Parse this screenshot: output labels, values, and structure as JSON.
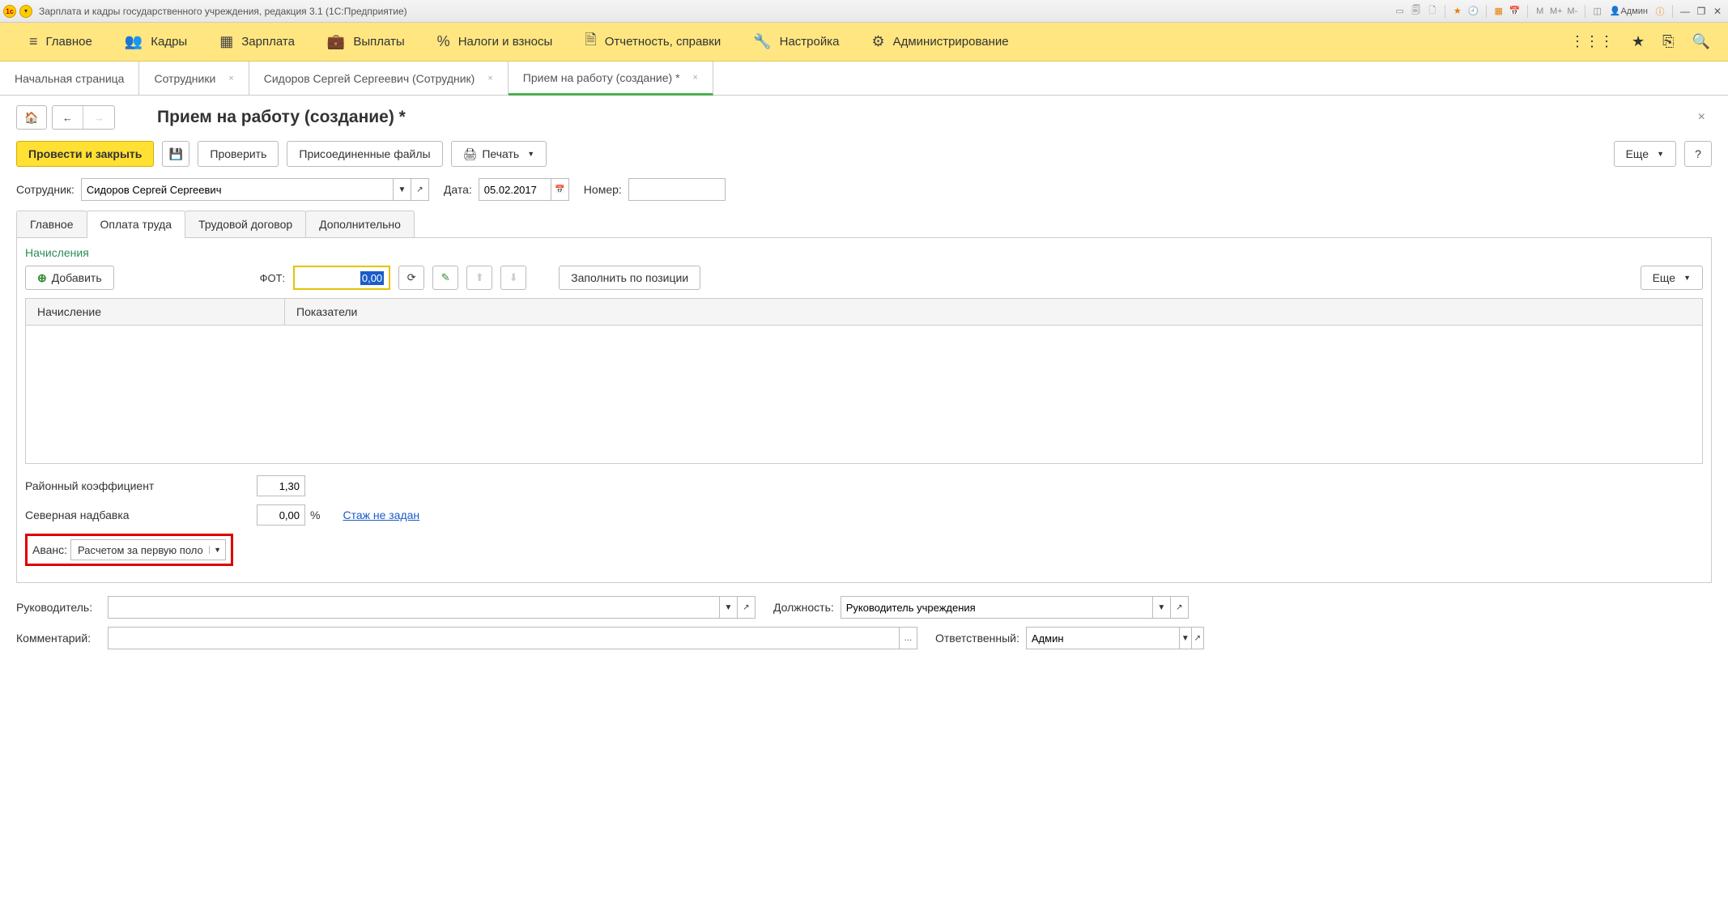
{
  "title_bar": {
    "app_title": "Зарплата и кадры государственного учреждения, редакция 3.1  (1С:Предприятие)",
    "user": "Админ"
  },
  "main_menu": {
    "items": [
      {
        "icon": "≡",
        "label": "Главное"
      },
      {
        "icon": "👥",
        "label": "Кадры"
      },
      {
        "icon": "▦",
        "label": "Зарплата"
      },
      {
        "icon": "💼",
        "label": "Выплаты"
      },
      {
        "icon": "%",
        "label": "Налоги и взносы"
      },
      {
        "icon": "🗎",
        "label": "Отчетность, справки"
      },
      {
        "icon": "🔧",
        "label": "Настройка"
      },
      {
        "icon": "⚙",
        "label": "Администрирование"
      }
    ]
  },
  "doc_tabs": [
    {
      "label": "Начальная страница",
      "closable": false
    },
    {
      "label": "Сотрудники",
      "closable": true
    },
    {
      "label": "Сидоров Сергей Сергеевич (Сотрудник)",
      "closable": true
    },
    {
      "label": "Прием на работу (создание) *",
      "closable": true,
      "active": true
    }
  ],
  "page": {
    "title": "Прием на работу (создание) *"
  },
  "actions": {
    "primary": "Провести и закрыть",
    "check": "Проверить",
    "files": "Присоединенные файлы",
    "print": "Печать",
    "more": "Еще"
  },
  "header_form": {
    "employee_label": "Сотрудник:",
    "employee_value": "Сидоров Сергей Сергеевич",
    "date_label": "Дата:",
    "date_value": "05.02.2017",
    "number_label": "Номер:",
    "number_value": ""
  },
  "subtabs": [
    "Главное",
    "Оплата труда",
    "Трудовой договор",
    "Дополнительно"
  ],
  "payroll": {
    "section_label": "Начисления",
    "add_btn": "Добавить",
    "fot_label": "ФОТ:",
    "fot_value": "0,00",
    "fill_btn": "Заполнить по позиции",
    "more_btn": "Еще",
    "columns": [
      "Начисление",
      "Показатели"
    ]
  },
  "lower": {
    "coef_label": "Районный коэффициент",
    "coef_value": "1,30",
    "north_label": "Северная надбавка",
    "north_value": "0,00",
    "north_unit": "%",
    "experience_link": "Стаж не задан",
    "advance_label": "Аванс:",
    "advance_value": "Расчетом за первую поло"
  },
  "bottom": {
    "manager_label": "Руководитель:",
    "manager_value": "",
    "position_label": "Должность:",
    "position_value": "Руководитель учреждения",
    "comment_label": "Комментарий:",
    "comment_value": "",
    "responsible_label": "Ответственный:",
    "responsible_value": "Админ"
  }
}
